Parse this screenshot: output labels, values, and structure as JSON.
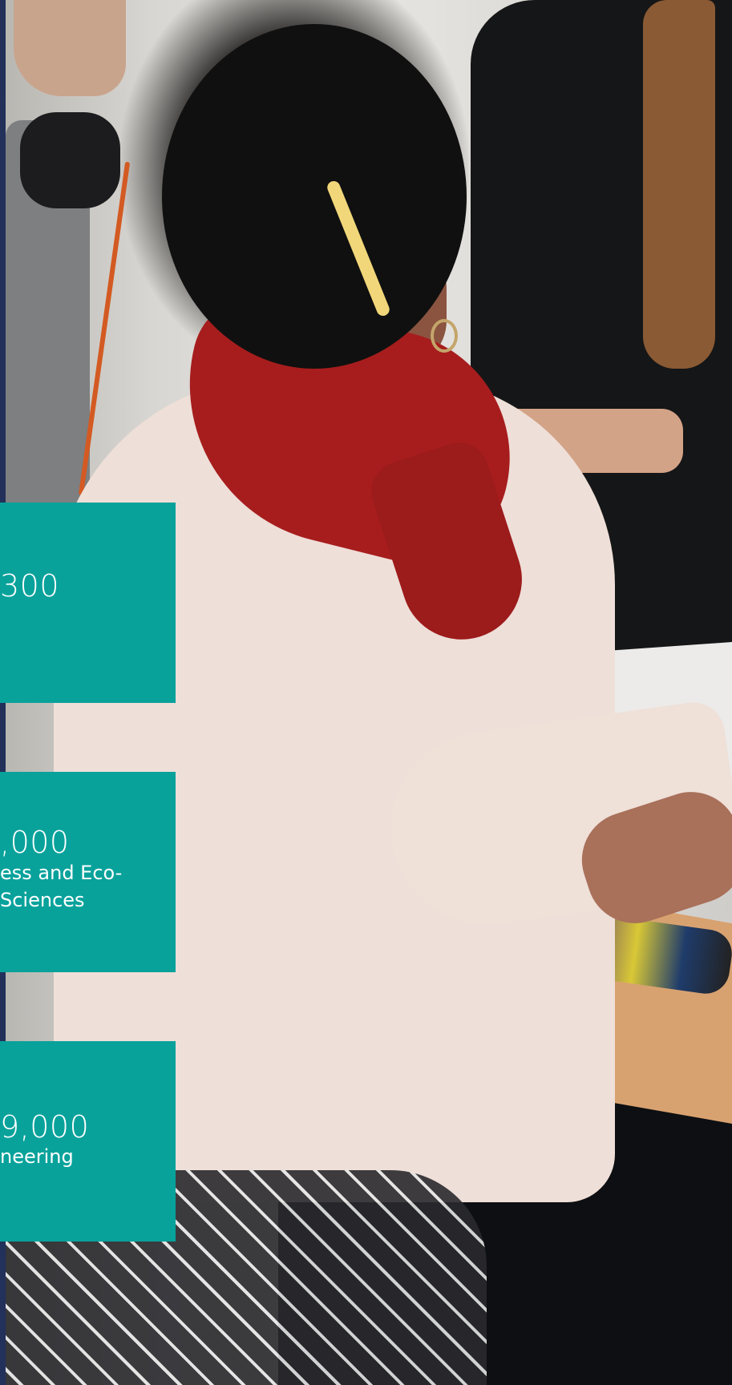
{
  "stats": [
    {
      "value": "300",
      "label_lines": []
    },
    {
      "value": ",000",
      "label_lines": [
        "ess and Eco-",
        "Sciences"
      ]
    },
    {
      "value": "9,000",
      "label_lines": [
        "neering"
      ]
    }
  ],
  "colors": {
    "accent": "#08a29b",
    "navy": "#22305a"
  },
  "image": {
    "icon": "photo-students-working"
  }
}
